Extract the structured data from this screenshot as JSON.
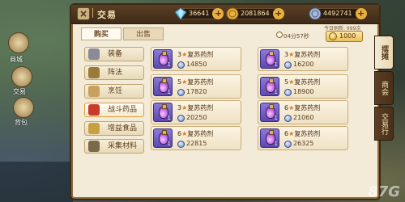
{
  "window": {
    "title": "交易",
    "close_icon": "×"
  },
  "currencies": [
    {
      "name": "diamond",
      "value": "36641",
      "color": "#7ad0f0"
    },
    {
      "name": "gold",
      "value": "2081864",
      "color": "#e8b040"
    },
    {
      "name": "silver",
      "value": "4492741",
      "color": "#a8b8d8"
    }
  ],
  "tabs": {
    "buy": "购买",
    "sell": "出售"
  },
  "refresh": {
    "timer": "04分57秒",
    "label": "今日刷新: 999次",
    "cost": "1000"
  },
  "categories": [
    {
      "label": "装备",
      "active": false,
      "icon_color": "#8a8a9a"
    },
    {
      "label": "阵法",
      "active": false,
      "icon_color": "#9a7a3a"
    },
    {
      "label": "烹饪",
      "active": false,
      "icon_color": "#c8a060"
    },
    {
      "label": "战斗药品",
      "active": true,
      "icon_color": "#c83a2a"
    },
    {
      "label": "增益食品",
      "active": false,
      "icon_color": "#c8a040"
    },
    {
      "label": "采集材料",
      "active": false,
      "icon_color": "#7a6a4a"
    }
  ],
  "items": [
    {
      "stars": "3",
      "name": "复苏药剂",
      "price": "14850",
      "count": "1"
    },
    {
      "stars": "3",
      "name": "复苏药剂",
      "price": "16200",
      "count": "1"
    },
    {
      "stars": "5",
      "name": "复苏药剂",
      "price": "17820",
      "count": "1"
    },
    {
      "stars": "5",
      "name": "复苏药剂",
      "price": "18900",
      "count": "1"
    },
    {
      "stars": "3",
      "name": "复苏药剂",
      "price": "20250",
      "count": "1"
    },
    {
      "stars": "6",
      "name": "复苏药剂",
      "price": "21060",
      "count": "1"
    },
    {
      "stars": "6",
      "name": "复苏药剂",
      "price": "22815",
      "count": "1"
    },
    {
      "stars": "6",
      "name": "复苏药剂",
      "price": "26325",
      "count": "1"
    }
  ],
  "side_tabs": [
    {
      "label": "摆摊",
      "active": true
    },
    {
      "label": "商会",
      "active": false
    },
    {
      "label": "交易行",
      "active": false
    }
  ],
  "hud": {
    "shop": "商城",
    "trade": "交易",
    "bag": "背包"
  },
  "watermark": "87G"
}
